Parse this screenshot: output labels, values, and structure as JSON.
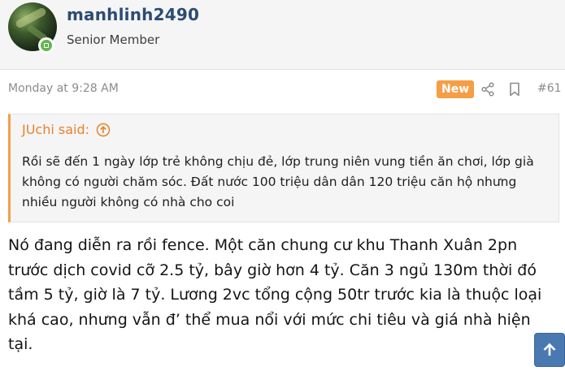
{
  "user": {
    "username": "manhlinh2490",
    "title": "Senior Member",
    "online": true
  },
  "post": {
    "date": "Monday at 9:28 AM",
    "new_label": "New",
    "number": "#61",
    "body": "Nó đang diễn ra rồi fence. Một căn chung cư khu Thanh Xuân 2pn trước dịch covid cỡ 2.5 tỷ, bây giờ hơn 4 tỷ. Căn 3 ngủ 130m thời đó tầm 5 tỷ, giờ là 7 tỷ. Lương 2vc tổng cộng 50tr trước kia là thuộc loại khá cao, nhưng vẫn đ’ thể mua nổi với mức chi tiêu và giá nhà hiện tại."
  },
  "quote": {
    "attribution": "JUchi said:",
    "text": "Rồi sẽ đến 1 ngày lớp trẻ không chịu đẻ, lớp trung niên vung tiền ăn chơi, lớp già không có người chăm sóc. Đất nước 100 triệu dân dân 120 triệu căn hộ nhưng nhiều người không có nhà cho coi"
  },
  "icons": {
    "share": "share-icon",
    "bookmark": "bookmark-icon",
    "quote_jump": "arrow-up-circle-icon",
    "scroll_top": "arrow-up-icon"
  },
  "colors": {
    "username": "#2b4c74",
    "accent": "#f59e45",
    "quote_attribution": "#e8822c",
    "scroll_button": "#4a79b1",
    "online": "#63b64f"
  }
}
